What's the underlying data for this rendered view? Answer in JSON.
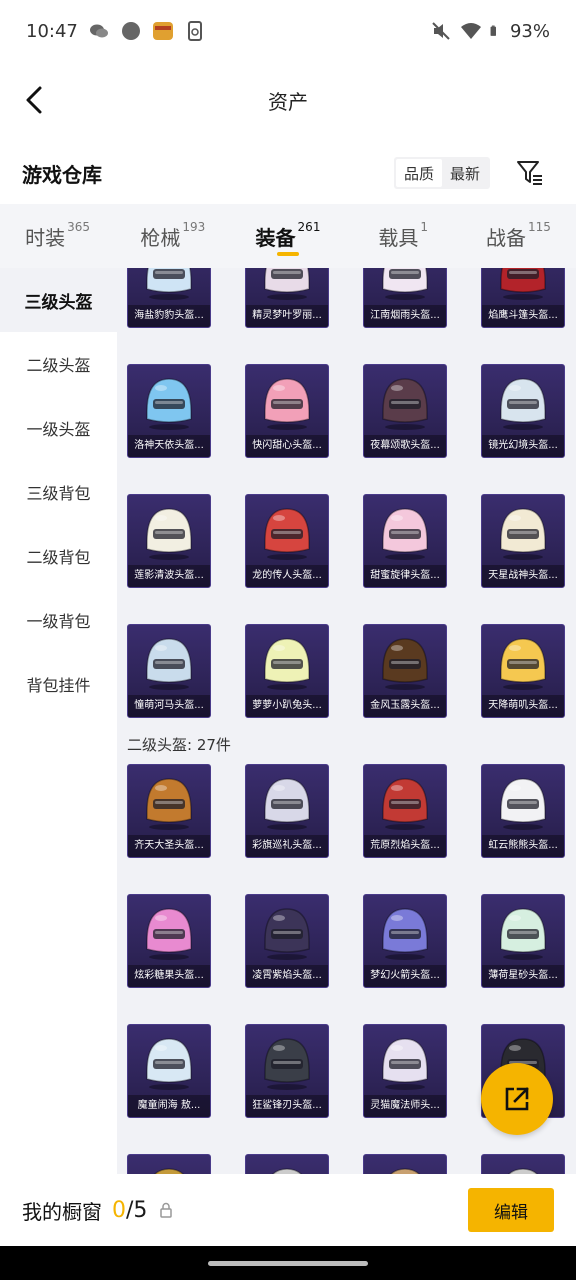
{
  "status_bar": {
    "time": "10:47",
    "battery": "93%",
    "icons": [
      "wechat-icon",
      "dot-icon",
      "app-badge-icon",
      "phone-sync-icon",
      "mute-icon",
      "wifi-icon",
      "battery-icon"
    ]
  },
  "header": {
    "title": "资产",
    "back_icon": "chevron-left-icon"
  },
  "warehouse": {
    "title": "游戏仓库",
    "sort_options": [
      "品质",
      "最新"
    ],
    "selected_sort": "品质",
    "filter_icon": "filter-icon"
  },
  "tabs": [
    {
      "label": "时装",
      "count": "365"
    },
    {
      "label": "枪械",
      "count": "193"
    },
    {
      "label": "装备",
      "count": "261",
      "active": true
    },
    {
      "label": "载具",
      "count": "1"
    },
    {
      "label": "战备",
      "count": "115"
    }
  ],
  "sidebar": {
    "items": [
      "三级头盔",
      "二级头盔",
      "一级头盔",
      "三级背包",
      "二级背包",
      "一级背包",
      "背包挂件"
    ],
    "active": "三级头盔"
  },
  "level3_items": [
    {
      "label": "海盐豹豹头盔...",
      "color": "#cfe4f5"
    },
    {
      "label": "精灵梦叶罗丽...",
      "color": "#e8dbe8"
    },
    {
      "label": "江南烟雨头盔...",
      "color": "#f0e6f2"
    },
    {
      "label": "焰鹰斗篷头盔...",
      "color": "#b3232a"
    },
    {
      "label": "洛神天依头盔...",
      "color": "#7fc6f0"
    },
    {
      "label": "快闪甜心头盔...",
      "color": "#f2a0b8"
    },
    {
      "label": "夜幕颂歌头盔...",
      "color": "#5a3c4a"
    },
    {
      "label": "镜光幻境头盔...",
      "color": "#d8e4ee"
    },
    {
      "label": "莲影清波头盔...",
      "color": "#f2efe2"
    },
    {
      "label": "龙的传人头盔...",
      "color": "#d6453f"
    },
    {
      "label": "甜蜜旋律头盔...",
      "color": "#f4c8dc"
    },
    {
      "label": "天星战神头盔...",
      "color": "#f2ead4"
    },
    {
      "label": "憧萌河马头盔...",
      "color": "#c9dcec"
    },
    {
      "label": "萝萝小趴兔头...",
      "color": "#eef2b6"
    },
    {
      "label": "金风玉露头盔...",
      "color": "#5a3a20"
    },
    {
      "label": "天降萌叽头盔...",
      "color": "#f5c850"
    }
  ],
  "section_level2": {
    "title": "二级头盔: 27件"
  },
  "level2_items": [
    {
      "label": "齐天大圣头盔...",
      "color": "#c27a2e"
    },
    {
      "label": "彩旗巡礼头盔...",
      "color": "#d8d8e8"
    },
    {
      "label": "荒原烈焰头盔...",
      "color": "#c23a34"
    },
    {
      "label": "虹云熊熊头盔...",
      "color": "#f2f2f4"
    },
    {
      "label": "炫彩糖果头盔...",
      "color": "#e88ad0"
    },
    {
      "label": "凌霄紫焰头盔...",
      "color": "#3c3458"
    },
    {
      "label": "梦幻火箭头盔...",
      "color": "#7a7ad8"
    },
    {
      "label": "薄荷星砂头盔...",
      "color": "#d6efe0"
    },
    {
      "label": "魔童闹海 敖...",
      "color": "#d8e8f4"
    },
    {
      "label": "狂鲨锋刃头盔...",
      "color": "#3a3e48"
    },
    {
      "label": "灵猫魔法师头...",
      "color": "#e6e0f0"
    },
    {
      "label": "",
      "color": "#2a2a30"
    },
    {
      "label": "",
      "color": "#c49a3a"
    },
    {
      "label": "",
      "color": "#cccccc"
    },
    {
      "label": "",
      "color": "#c8a070"
    },
    {
      "label": "",
      "color": "#cccccc"
    }
  ],
  "fab": {
    "icon": "share-external-icon"
  },
  "bottom_bar": {
    "showcase_label": "我的橱窗",
    "current": "0",
    "total": "/5",
    "lock_icon": "lock-icon",
    "edit_label": "编辑"
  }
}
